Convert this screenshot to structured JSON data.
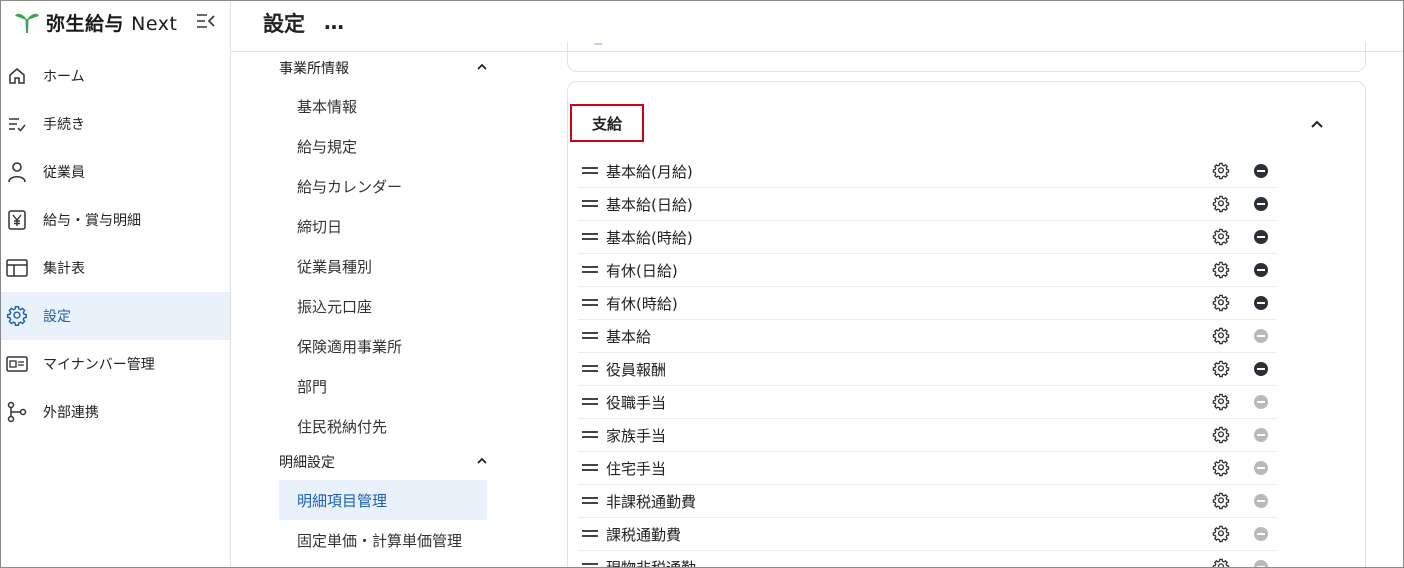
{
  "app": {
    "name": "弥生給与",
    "name_suffix": "Next"
  },
  "sidebar": {
    "items": [
      {
        "label": "ホーム",
        "icon": "home-icon",
        "active": false
      },
      {
        "label": "手続き",
        "icon": "checklist-icon",
        "active": false
      },
      {
        "label": "従業員",
        "icon": "person-icon",
        "active": false
      },
      {
        "label": "給与・賞与明細",
        "icon": "yen-document-icon",
        "active": false
      },
      {
        "label": "集計表",
        "icon": "table-icon",
        "active": false
      },
      {
        "label": "設定",
        "icon": "gear-icon",
        "active": true
      },
      {
        "label": "マイナンバー管理",
        "icon": "id-card-icon",
        "active": false
      },
      {
        "label": "外部連携",
        "icon": "link-nodes-icon",
        "active": false
      }
    ]
  },
  "header": {
    "title": "設定",
    "more": "…"
  },
  "subnav": {
    "groups": [
      {
        "label": "事業所情報",
        "items": [
          "基本情報",
          "給与規定",
          "給与カレンダー",
          "締切日",
          "従業員種別",
          "振込元口座",
          "保険適用事業所",
          "部門",
          "住民税納付先"
        ]
      },
      {
        "label": "明細設定",
        "items": [
          "明細項目管理",
          "固定単価・計算単価管理"
        ]
      }
    ],
    "active_item": "明細項目管理"
  },
  "main": {
    "section_title": "支給",
    "rows": [
      {
        "label": "基本給(月給)",
        "removable": true
      },
      {
        "label": "基本給(日給)",
        "removable": true
      },
      {
        "label": "基本給(時給)",
        "removable": true
      },
      {
        "label": "有休(日給)",
        "removable": true
      },
      {
        "label": "有休(時給)",
        "removable": true
      },
      {
        "label": "基本給",
        "removable": false
      },
      {
        "label": "役員報酬",
        "removable": true
      },
      {
        "label": "役職手当",
        "removable": false
      },
      {
        "label": "家族手当",
        "removable": false
      },
      {
        "label": "住宅手当",
        "removable": false
      },
      {
        "label": "非課税通勤費",
        "removable": false
      },
      {
        "label": "課税通勤費",
        "removable": false
      },
      {
        "label": "現物非税通勤",
        "removable": false
      }
    ]
  },
  "colors": {
    "accent": "#1d5fb5",
    "active_bg": "#e9f2fb",
    "highlight_border": "#d0021b",
    "logo_green": "#3aa655"
  }
}
